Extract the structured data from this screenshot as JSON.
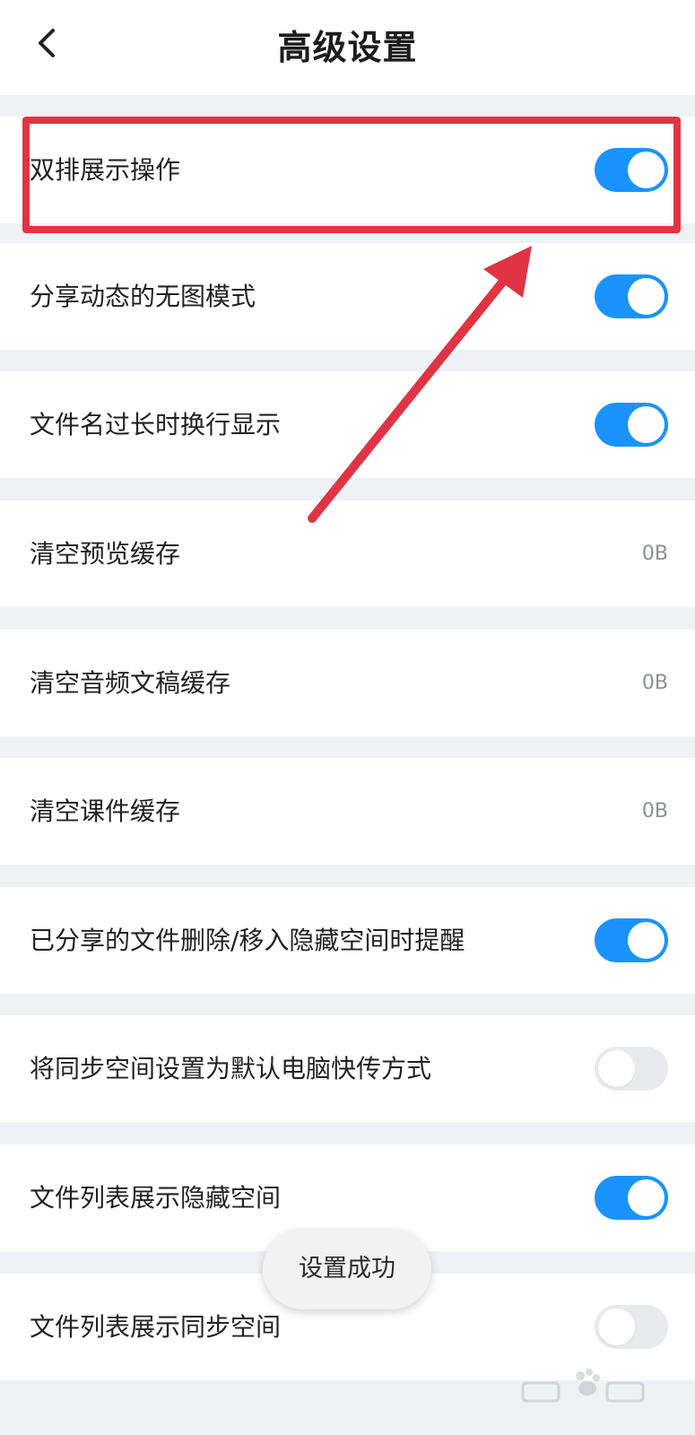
{
  "header": {
    "title": "高级设置",
    "back_icon": "chevron-left-icon"
  },
  "settings": [
    {
      "label": "双排展示操作",
      "type": "toggle",
      "on": true
    },
    {
      "label": "分享动态的无图模式",
      "type": "toggle",
      "on": true
    },
    {
      "label": "文件名过长时换行显示",
      "type": "toggle",
      "on": true
    },
    {
      "label": "清空预览缓存",
      "type": "value",
      "value": "0B"
    },
    {
      "label": "清空音频文稿缓存",
      "type": "value",
      "value": "0B"
    },
    {
      "label": "清空课件缓存",
      "type": "value",
      "value": "0B"
    },
    {
      "label": "已分享的文件删除/移入隐藏空间时提醒",
      "type": "toggle",
      "on": true
    },
    {
      "label": "将同步空间设置为默认电脑快传方式",
      "type": "toggle",
      "on": false
    },
    {
      "label": "文件列表展示隐藏空间",
      "type": "toggle",
      "on": true
    },
    {
      "label": "文件列表展示同步空间",
      "type": "toggle",
      "on": false
    }
  ],
  "toast": {
    "text": "设置成功"
  },
  "colors": {
    "accent": "#1a93ff",
    "annotation": "#e03444",
    "toggle_off": "#e9eaed"
  }
}
